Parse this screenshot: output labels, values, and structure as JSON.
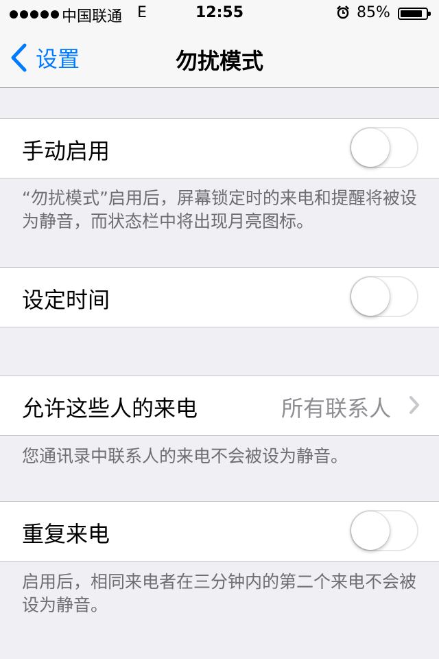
{
  "status_bar": {
    "carrier": "中国联通",
    "network": "E",
    "time": "12:55",
    "battery_percent": "85%",
    "battery_level": 0.85
  },
  "nav": {
    "back_label": "设置",
    "title": "勿扰模式"
  },
  "settings": {
    "manual": {
      "label": "手动启用",
      "on": false
    },
    "manual_footer": "“勿扰模式”启用后，屏幕锁定时的来电和提醒将被设为静音，而状态栏中将出现月亮图标。",
    "scheduled": {
      "label": "设定时间",
      "on": false
    },
    "allow_calls": {
      "label": "允许这些人的来电",
      "value": "所有联系人"
    },
    "allow_footer": "您通讯录中联系人的来电不会被设为静音。",
    "repeated": {
      "label": "重复来电",
      "on": false
    },
    "repeated_footer": "启用后，相同来电者在三分钟内的第二个来电不会被设为静音。"
  },
  "colors": {
    "accent": "#007aff",
    "background": "#efeff4",
    "secondary_text": "#6d6d72"
  }
}
